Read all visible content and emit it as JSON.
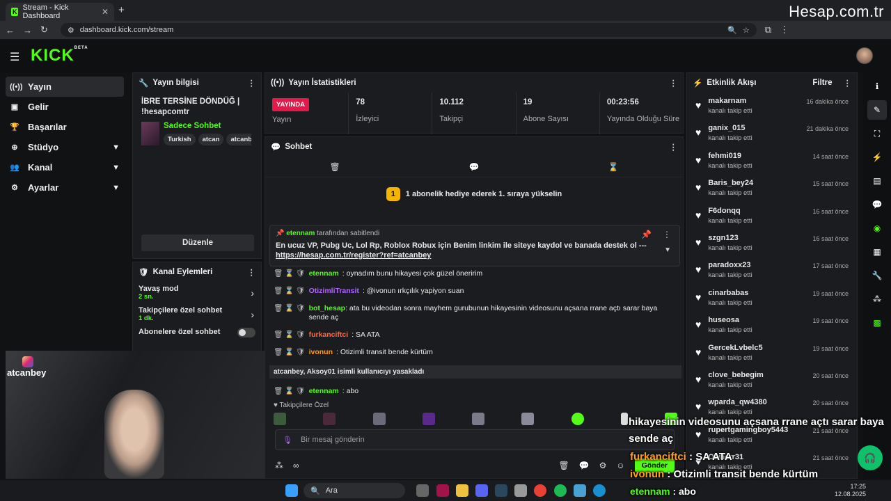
{
  "browser": {
    "tab_title": "Stream - Kick Dashboard",
    "url": "dashboard.kick.com/stream",
    "brand_watermark": "Hesap.com.tr"
  },
  "app": {
    "logo": "KICK",
    "logo_sup": "BETA"
  },
  "sidebar": {
    "items": [
      {
        "label": "Yayın"
      },
      {
        "label": "Gelir"
      },
      {
        "label": "Başarılar"
      },
      {
        "label": "Stüdyo"
      },
      {
        "label": "Kanal"
      },
      {
        "label": "Ayarlar"
      }
    ]
  },
  "stream_info": {
    "header": "Yayın bilgisi",
    "title": "İBRE TERSİNE DÖNDÜĞ | !hesapcomtr",
    "category": "Sadece Sohbet",
    "tags": [
      "Turkish",
      "atcan",
      "atcanbe"
    ],
    "edit_label": "Düzenle"
  },
  "channel_actions": {
    "header": "Kanal Eylemleri",
    "items": [
      {
        "title": "Yavaş mod",
        "sub": "2 sn."
      },
      {
        "title": "Takipçilere özel sohbet",
        "sub": "1 dk."
      },
      {
        "title": "Abonelere özel sohbet",
        "sub": ""
      }
    ]
  },
  "stats": {
    "header": "Yayın İstatistikleri",
    "live_label": "YAYINDA",
    "live_caption": "Yayın",
    "items": [
      {
        "value": "78",
        "label": "İzleyici"
      },
      {
        "value": "10.112",
        "label": "Takipçi"
      },
      {
        "value": "19",
        "label": "Abone Sayısı"
      },
      {
        "value": "00:23:56",
        "label": "Yayında Olduğu Süre"
      }
    ]
  },
  "chat": {
    "header": "Sohbet",
    "goal_number": "1",
    "goal_text": "1 abonelik hediye ederek 1. sıraya yükselin",
    "pinned_by": "etennam",
    "pinned_suffix": "tarafından sabitlendi",
    "pinned_text": "En ucuz VP, Pubg Uc, Lol Rp, Roblox Robux için Benim linkim ile siteye kaydol ve banada destek ol ---",
    "pinned_link": "https://hesap.com.tr/register?ref=atcanbey",
    "messages": [
      {
        "user": "etennam",
        "text": ": oynadım bunu hikayesi çok güzel öneririm",
        "color": "#53fc18"
      },
      {
        "user": "OtizimliTransit",
        "text": ": @ivonun ırkçılık yapiyon suan",
        "color": "#b066ff"
      },
      {
        "user": "bot_hesap",
        "text": ": ata bu videodan sonra mayhem gurubunun hikayesinin videosunu açsana rrane açtı sarar baya sende aç",
        "color": "#53fc18"
      },
      {
        "user": "furkanciftci",
        "text": ": SA ATA",
        "color": "#ff6b3d"
      },
      {
        "user": "ivonun",
        "text": ": Otizimli transit bende kürtüm",
        "color": "#ff9d1c"
      }
    ],
    "ban_notice": "atcanbey, Aksoy01 isimli kullanıcıyı yasakladı",
    "last_message": {
      "user": "etennam",
      "text": ": abo",
      "color": "#53fc18"
    },
    "emotes_header": "Takipçilere Özel",
    "input_placeholder": "Bir mesaj gönderin",
    "send_label": "Gönder"
  },
  "feed": {
    "header": "Etkinlik Akışı",
    "filter_label": "Filtre",
    "items": [
      {
        "name": "makarnam",
        "desc": "kanalı takip etti",
        "time": "16 dakika önce"
      },
      {
        "name": "ganix_015",
        "desc": "kanalı takip etti",
        "time": "21 dakika önce"
      },
      {
        "name": "fehmi019",
        "desc": "kanalı takip etti",
        "time": "14 saat önce"
      },
      {
        "name": "Baris_bey24",
        "desc": "kanalı takip etti",
        "time": "15 saat önce"
      },
      {
        "name": "F6donqq",
        "desc": "kanalı takip etti",
        "time": "16 saat önce"
      },
      {
        "name": "szgn123",
        "desc": "kanalı takip etti",
        "time": "16 saat önce"
      },
      {
        "name": "paradoxx23",
        "desc": "kanalı takip etti",
        "time": "17 saat önce"
      },
      {
        "name": "cinarbabas",
        "desc": "kanalı takip etti",
        "time": "19 saat önce"
      },
      {
        "name": "huseosa",
        "desc": "kanalı takip etti",
        "time": "19 saat önce"
      },
      {
        "name": "GercekLvbelc5",
        "desc": "kanalı takip etti",
        "time": "19 saat önce"
      },
      {
        "name": "clove_bebegim",
        "desc": "kanalı takip etti",
        "time": "20 saat önce"
      },
      {
        "name": "wparda_qw4380",
        "desc": "kanalı takip etti",
        "time": "20 saat önce"
      },
      {
        "name": "rupertgamingboy5443",
        "desc": "kanalı takip etti",
        "time": "21 saat önce"
      },
      {
        "name": "Ownerr31",
        "desc": "kanalı takip etti",
        "time": "21 saat önce"
      }
    ]
  },
  "camera": {
    "name": "atcanbey"
  },
  "overlay": {
    "line1": "hikayesinin videosunu açsana rrane açtı sarar baya",
    "line2": "sende aç",
    "line3_user": "furkanciftci",
    "line3_text": " : SA ATA",
    "line4_user": "ivonun",
    "line4_text": " : Otizimli transit bende kürtüm",
    "line5_user": "etennam",
    "line5_text": " : abo"
  },
  "taskbar": {
    "search_label": "Ara",
    "time": "17:25",
    "date": "12.08.2025"
  },
  "colors": {
    "accent": "#53fc18",
    "live": "#e3194a"
  }
}
